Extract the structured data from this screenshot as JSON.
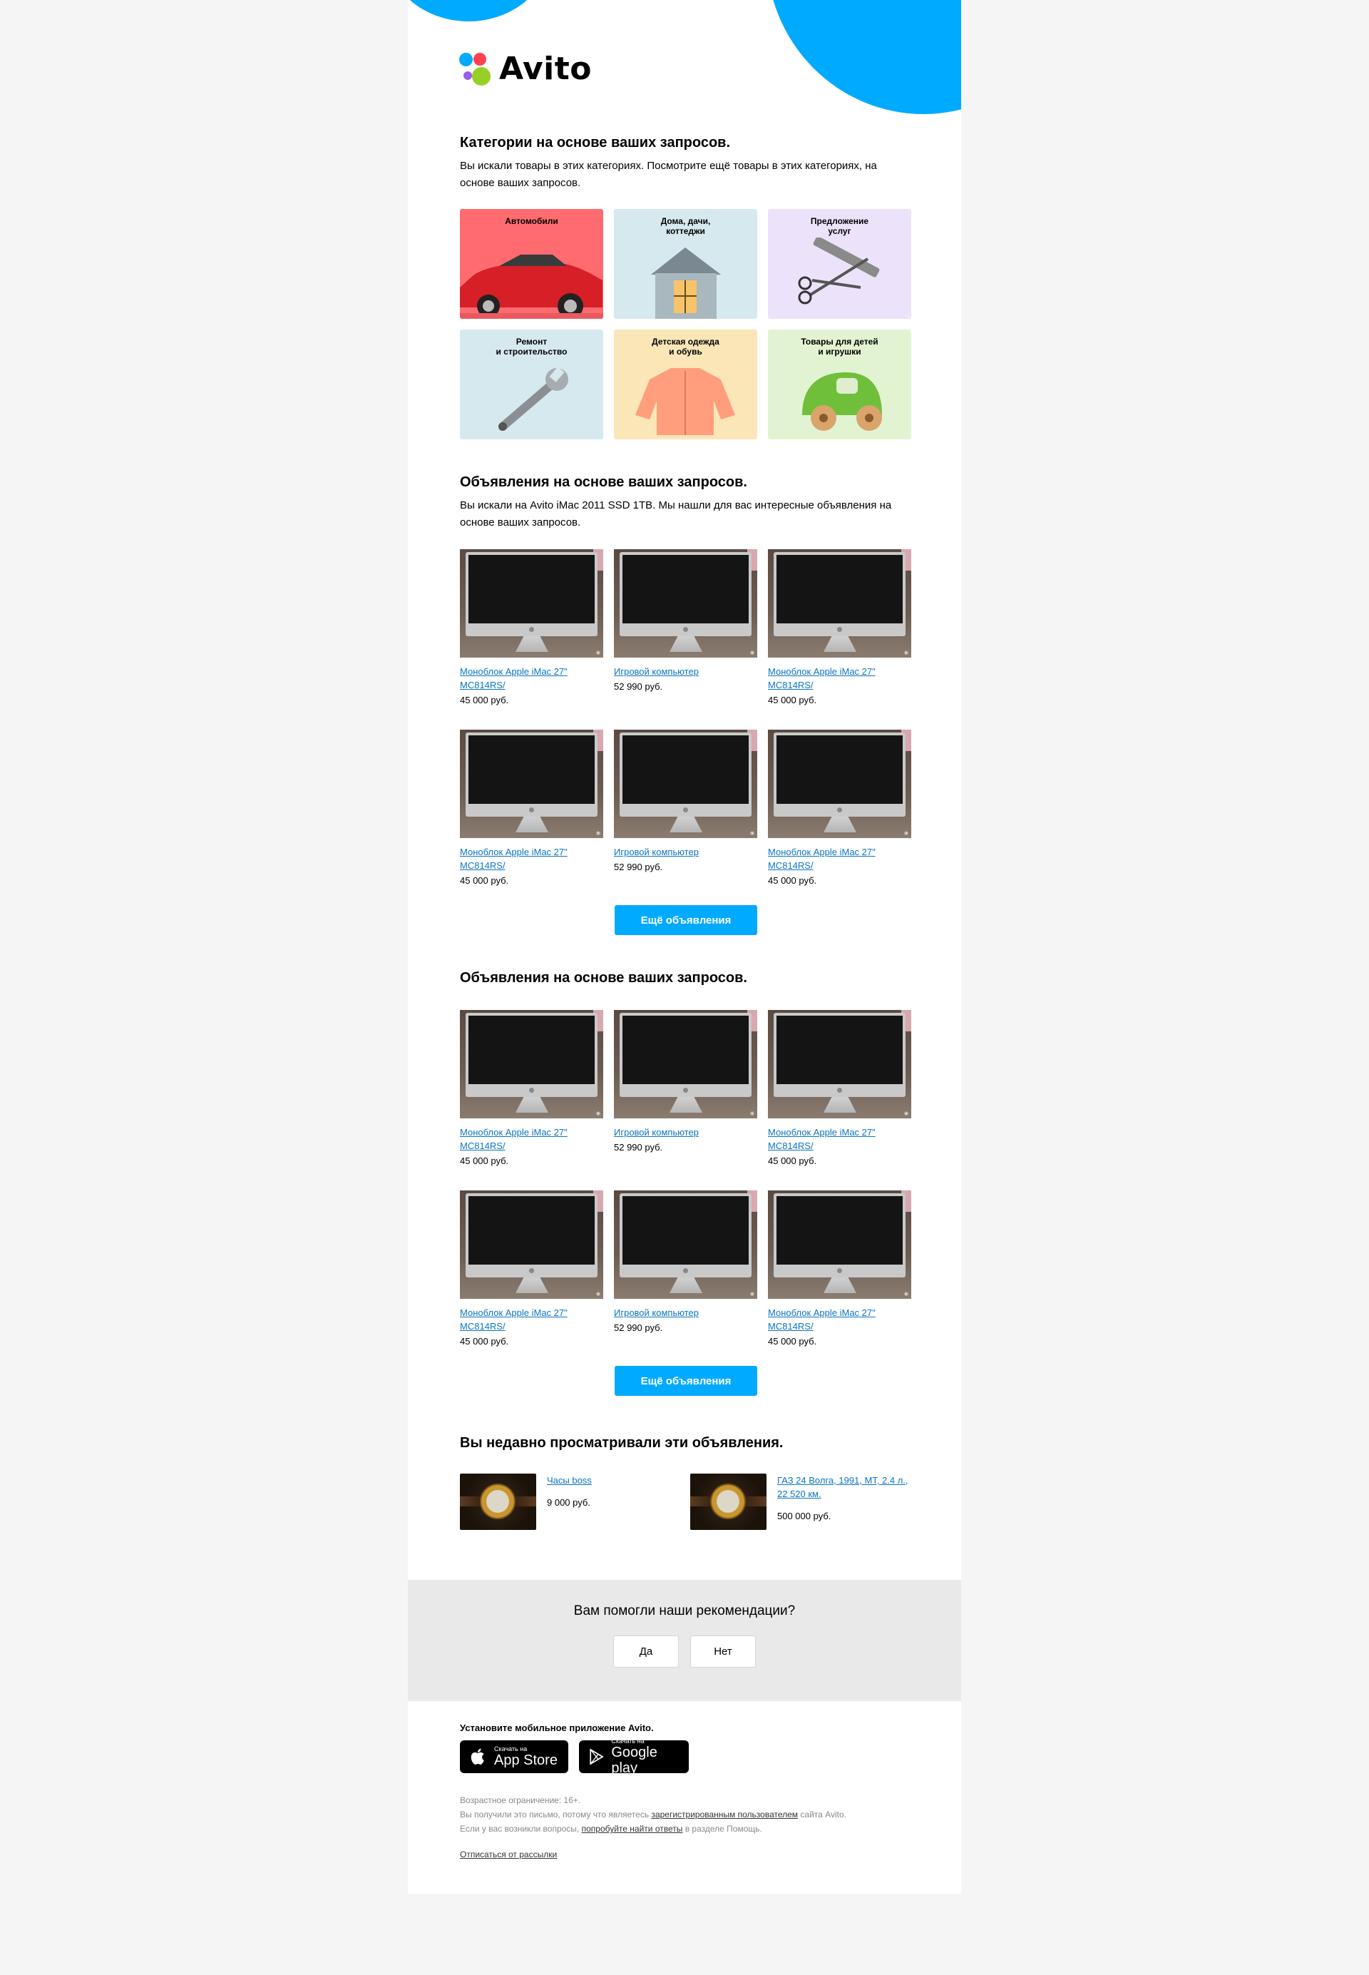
{
  "brand": {
    "logo_text": "Avito",
    "accent_color": "#00aaff",
    "dot_colors": [
      "#00aaff",
      "#ff4053",
      "#965eeb",
      "#97cf26"
    ]
  },
  "categories_section": {
    "title": "Категории на основе ваших запросов.",
    "text": "Вы искали товары в этих категориях. Посмотрите ещё товары в этих категориях, на основе ваших запросов.",
    "tiles": [
      {
        "label": "Автомобили",
        "bg": "#ff6b6f",
        "icon": "car-icon"
      },
      {
        "label": "Дома, дачи,\nкоттеджи",
        "bg": "#d6e9ef",
        "icon": "house-icon"
      },
      {
        "label": "Предложение\nуслуг",
        "bg": "#ece3fb",
        "icon": "scissors-comb-icon"
      },
      {
        "label": "Ремонт\nи строительство",
        "bg": "#d6e9ef",
        "icon": "wrench-icon"
      },
      {
        "label": "Детская одежда\nи обувь",
        "bg": "#fbe6b8",
        "icon": "kids-jacket-icon"
      },
      {
        "label": "Товары для детей\nи игрушки",
        "bg": "#e2f3d2",
        "icon": "toy-car-icon"
      }
    ]
  },
  "listings_section_1": {
    "title": "Объявления на основе ваших запросов.",
    "text": "Вы искали на Avito iMac 2011 SSD 1TB. Мы нашли для вас интересные объявления на основе ваших запросов.",
    "items": [
      {
        "title": "Моноблок Apple iMac 27\" MC814RS/",
        "price": "45 000 руб."
      },
      {
        "title": "Игровой компьютер",
        "price": "52 990 руб."
      },
      {
        "title": "Моноблок Apple iMac 27\" MC814RS/",
        "price": "45 000 руб."
      },
      {
        "title": "Моноблок Apple iMac 27\" MC814RS/",
        "price": "45 000 руб."
      },
      {
        "title": "Игровой компьютер",
        "price": "52 990 руб."
      },
      {
        "title": "Моноблок Apple iMac 27\" MC814RS/",
        "price": "45 000 руб."
      }
    ],
    "more_label": "Ещё объявления"
  },
  "listings_section_2": {
    "title": "Объявления на основе ваших запросов.",
    "items": [
      {
        "title": "Моноблок Apple iMac 27\" MC814RS/",
        "price": "45 000 руб."
      },
      {
        "title": "Игровой компьютер",
        "price": "52 990 руб."
      },
      {
        "title": "Моноблок Apple iMac 27\" MC814RS/",
        "price": "45 000 руб."
      },
      {
        "title": "Моноблок Apple iMac 27\" MC814RS/",
        "price": "45 000 руб."
      },
      {
        "title": "Игровой компьютер",
        "price": "52 990 руб."
      },
      {
        "title": "Моноблок Apple iMac 27\" MC814RS/",
        "price": "45 000 руб."
      }
    ],
    "more_label": "Ещё объявления"
  },
  "recent_section": {
    "title": "Вы недавно просматривали эти объявления.",
    "items": [
      {
        "title": "Часы boss",
        "price": "9 000 руб."
      },
      {
        "title": "ГАЗ 24 Волга, 1991, MT, 2.4 л., 22 520 км.",
        "price": "500 000 руб."
      }
    ]
  },
  "feedback": {
    "question": "Вам помогли наши рекомендации?",
    "yes_label": "Да",
    "no_label": "Нет"
  },
  "footer": {
    "app_title": "Установите мобильное приложение Avito.",
    "app_store_small": "Скачать на",
    "app_store_big": "App Store",
    "google_play_small": "Скачать на",
    "google_play_big": "Google play",
    "age_limit": "Возрастное ограничение: 16+.",
    "reason_prefix": "Вы получили это письмо, потому что являетесь",
    "reason_link": "зарегистрированным пользователем",
    "reason_suffix": "сайта Avito.",
    "help_prefix": "Если у вас возникли вопросы,",
    "help_link": "попробуйте найти ответы",
    "help_suffix": "в разделе Помощь.",
    "unsubscribe": "Отписаться от рассылки"
  }
}
